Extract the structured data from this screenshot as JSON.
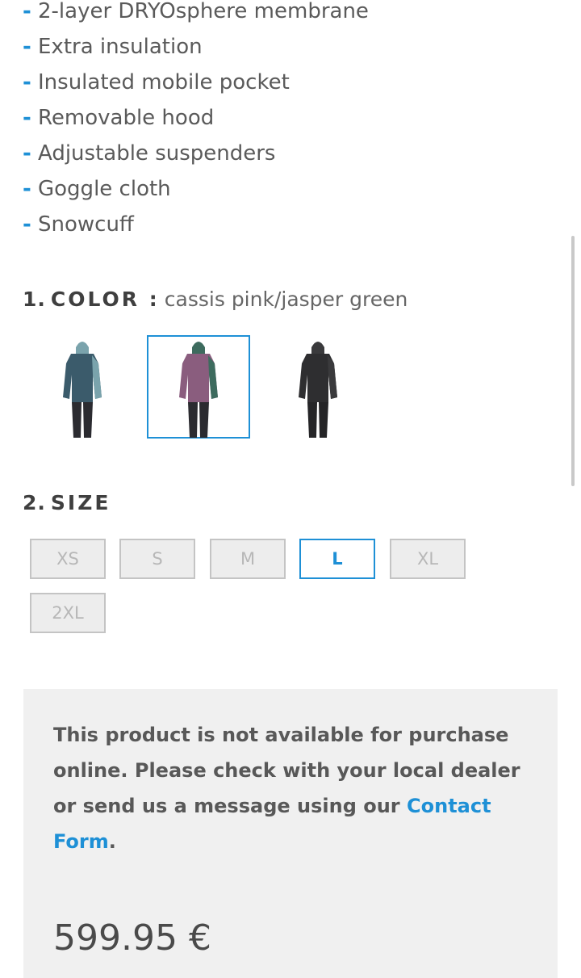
{
  "features": [
    {
      "dash": "-",
      "text": "2-layer DRYOsphere membrane"
    },
    {
      "dash": "-",
      "text": "Extra insulation"
    },
    {
      "dash": "-",
      "text": "Insulated mobile pocket"
    },
    {
      "dash": "-",
      "text": "Removable hood"
    },
    {
      "dash": "-",
      "text": "Adjustable suspenders"
    },
    {
      "dash": "-",
      "text": "Goggle cloth"
    },
    {
      "dash": "-",
      "text": "Snowcuff"
    }
  ],
  "color_section": {
    "number": "1.",
    "label": "COLOR",
    "separator": ":",
    "selected_value": "cassis pink/jasper green",
    "swatches": [
      {
        "icon": "ski-suit-teal-icon",
        "colors": {
          "body": "#3b5b6b",
          "accent": "#7aa3ac",
          "legs": "#2b2b30"
        },
        "selected": false
      },
      {
        "icon": "ski-suit-pink-green-icon",
        "colors": {
          "body": "#8a5d7e",
          "accent": "#3d6b5e",
          "legs": "#2b2b30"
        },
        "selected": true
      },
      {
        "icon": "ski-suit-black-icon",
        "colors": {
          "body": "#2e2e30",
          "accent": "#3a3a3c",
          "legs": "#252527"
        },
        "selected": false
      }
    ]
  },
  "size_section": {
    "number": "2.",
    "label": "SIZE",
    "sizes": [
      {
        "label": "XS",
        "selected": false
      },
      {
        "label": "S",
        "selected": false
      },
      {
        "label": "M",
        "selected": false
      },
      {
        "label": "L",
        "selected": true
      },
      {
        "label": "XL",
        "selected": false
      },
      {
        "label": "2XL",
        "selected": false
      }
    ]
  },
  "notice": {
    "text_before": "This product is not available for purchase online. Please check with your local dealer or send us a message using our ",
    "link_text": "Contact Form",
    "text_after": "."
  },
  "price": "599.95 €",
  "colors": {
    "accent": "#1e90d6",
    "text": "#555555",
    "notice_bg": "#f0f0f0"
  }
}
